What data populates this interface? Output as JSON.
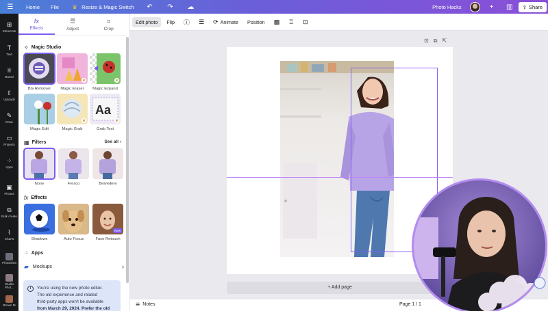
{
  "topbar": {
    "home": "Home",
    "file": "File",
    "resize": "Resize & Magic Switch",
    "doc_title": "Photo Hacks",
    "share": "Share"
  },
  "rail": [
    {
      "label": "Elements",
      "icon": "elements-icon"
    },
    {
      "label": "Text",
      "icon": "text-icon"
    },
    {
      "label": "Brand",
      "icon": "brand-icon"
    },
    {
      "label": "Uploads",
      "icon": "uploads-icon"
    },
    {
      "label": "Draw",
      "icon": "draw-icon"
    },
    {
      "label": "Projects",
      "icon": "projects-icon"
    },
    {
      "label": "Apps",
      "icon": "apps-icon"
    },
    {
      "label": "Photos",
      "icon": "photos-icon"
    },
    {
      "label": "Bulk create",
      "icon": "bulk-create-icon"
    },
    {
      "label": "Charts",
      "icon": "charts-icon"
    },
    {
      "label": "Photoshot",
      "icon": "photoshot-icon"
    },
    {
      "label": "Studio Phot...",
      "icon": "studio-photo-icon"
    },
    {
      "label": "Brown M",
      "icon": "brown-m-icon"
    }
  ],
  "panel": {
    "tabs": [
      {
        "label": "Effects",
        "icon": "fx-icon"
      },
      {
        "label": "Adjust",
        "icon": "adjust-icon"
      },
      {
        "label": "Crop",
        "icon": "crop-icon"
      }
    ],
    "magic_studio": {
      "title": "Magic Studio",
      "items": [
        "BG Remover",
        "Magic Eraser",
        "Magic Expand",
        "Magic Edit",
        "Magic Grab",
        "Grab Text"
      ]
    },
    "filters": {
      "title": "Filters",
      "see_all": "See all",
      "items": [
        "None",
        "Fresco",
        "Belvedere"
      ]
    },
    "effects": {
      "title": "Effects",
      "items": [
        "Shadows",
        "Auto Focus",
        "Face Retouch"
      ],
      "new_badge": "New"
    },
    "apps": {
      "title": "Apps",
      "mockups": "Mockups"
    },
    "notice": {
      "line1": "You're using the new photo editor.",
      "line2": "The old experience and related",
      "line3": "third-party apps won't be available",
      "line4": "from March 29, 2024. Prefer the old"
    }
  },
  "toolbar": {
    "edit_photo": "Edit photo",
    "flip": "Flip",
    "animate": "Animate",
    "position": "Position"
  },
  "canvas": {
    "add_page": "+ Add page"
  },
  "bottombar": {
    "notes": "Notes",
    "page_count": "Page 1 / 1"
  },
  "colors": {
    "accent": "#7b5cf0",
    "rail_bg": "#18191b",
    "canvas_bg": "#e9e9ee"
  }
}
